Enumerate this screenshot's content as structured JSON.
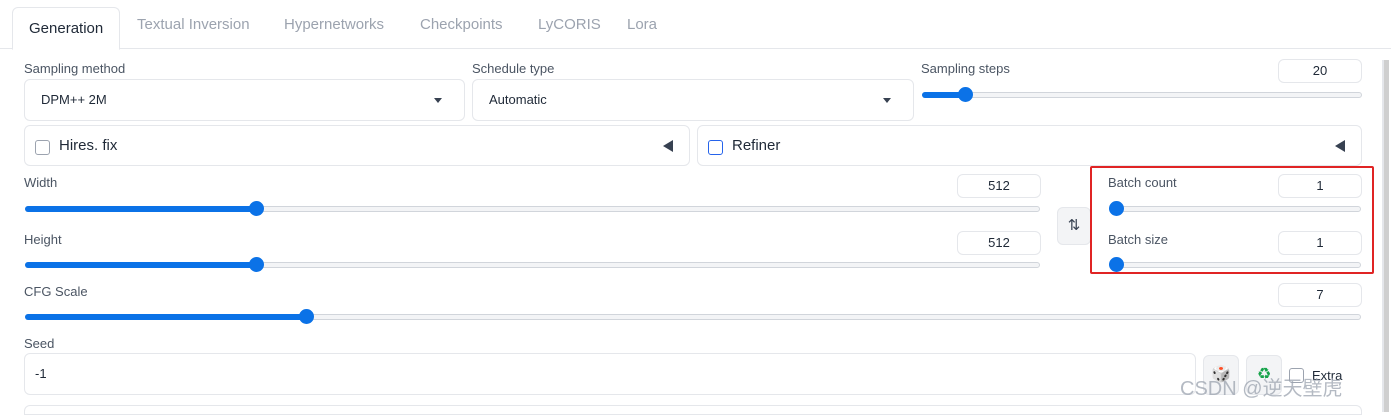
{
  "tabs": [
    "Generation",
    "Textual Inversion",
    "Hypernetworks",
    "Checkpoints",
    "LyCORIS",
    "Lora"
  ],
  "sampling_method": {
    "label": "Sampling method",
    "value": "DPM++ 2M"
  },
  "schedule_type": {
    "label": "Schedule type",
    "value": "Automatic"
  },
  "sampling_steps": {
    "label": "Sampling steps",
    "value": "20",
    "fraction": 0.097
  },
  "hires_fix": {
    "label": "Hires. fix",
    "checked": false
  },
  "refiner": {
    "label": "Refiner",
    "checked": false
  },
  "width": {
    "label": "Width",
    "value": "512",
    "fraction": 0.228
  },
  "height": {
    "label": "Height",
    "value": "512",
    "fraction": 0.228
  },
  "swap_icon": "⇅",
  "batch_count": {
    "label": "Batch count",
    "value": "1",
    "fraction": 0.0
  },
  "batch_size": {
    "label": "Batch size",
    "value": "1",
    "fraction": 0.0
  },
  "cfg_scale": {
    "label": "CFG Scale",
    "value": "7",
    "fraction": 0.21
  },
  "seed": {
    "label": "Seed",
    "value": "-1",
    "extra_label": "Extra"
  },
  "icons": {
    "dice": "🎲",
    "recycle": "♻"
  },
  "watermark": "CSDN @逆天壁虎",
  "colors": {
    "accent": "#0b72e7",
    "highlight": "#e02424"
  }
}
